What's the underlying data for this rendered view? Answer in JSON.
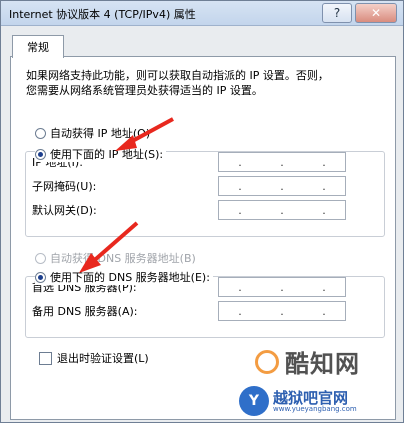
{
  "window": {
    "title": "Internet 协议版本 4 (TCP/IPv4) 属性",
    "help_button": "?",
    "close_button": "✕"
  },
  "tab": {
    "label": "常规"
  },
  "description": {
    "line1": "如果网络支持此功能，则可以获取自动指派的 IP 设置。否则，",
    "line2": "您需要从网络系统管理员处获得适当的 IP 设置。"
  },
  "ip_section": {
    "auto_radio": "自动获得 IP 地址(O)",
    "manual_radio": "使用下面的 IP 地址(S):",
    "fields": [
      {
        "label": "IP 地址(I):",
        "value": ". . ."
      },
      {
        "label": "子网掩码(U):",
        "value": ". . ."
      },
      {
        "label": "默认网关(D):",
        "value": ". . ."
      }
    ]
  },
  "dns_section": {
    "auto_radio": "自动获得 DNS 服务器地址(B)",
    "manual_radio": "使用下面的 DNS 服务器地址(E):",
    "fields": [
      {
        "label": "首选 DNS 服务器(P):",
        "value": ". . ."
      },
      {
        "label": "备用 DNS 服务器(A):",
        "value": ". . ."
      }
    ]
  },
  "validate_checkbox": "退出时验证设置(L)",
  "watermark": {
    "logo_text": "酷知网",
    "site_title": "越狱吧官网",
    "site_url": "www.yueyangbang.com",
    "icon_letter": "Y"
  },
  "colors": {
    "arrow": "#e8281e",
    "accent": "#1d3f8d"
  }
}
